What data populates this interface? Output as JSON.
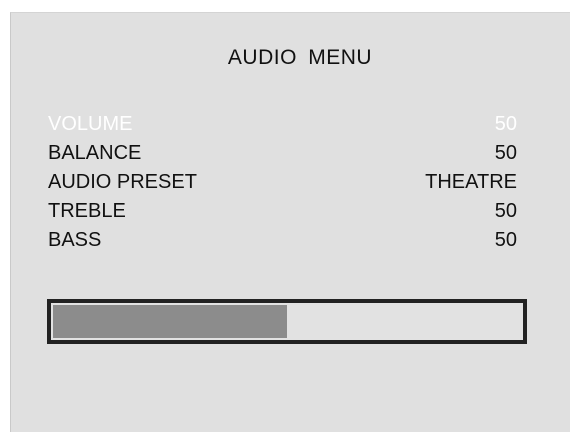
{
  "menu": {
    "title": "AUDIO MENU",
    "selected_index": 0,
    "items": [
      {
        "label": "VOLUME",
        "value": "50"
      },
      {
        "label": "BALANCE",
        "value": "50"
      },
      {
        "label": "AUDIO PRESET",
        "value": "THEATRE"
      },
      {
        "label": "TREBLE",
        "value": "50"
      },
      {
        "label": "BASS",
        "value": "50"
      }
    ]
  },
  "level_bar": {
    "value": 50,
    "max": 100
  },
  "colors": {
    "panel_background": "#e0e0e0",
    "selected_text": "#ffffff",
    "normal_text": "#111111",
    "bar_fill": "#8c8c8c",
    "bar_border": "#222222"
  }
}
